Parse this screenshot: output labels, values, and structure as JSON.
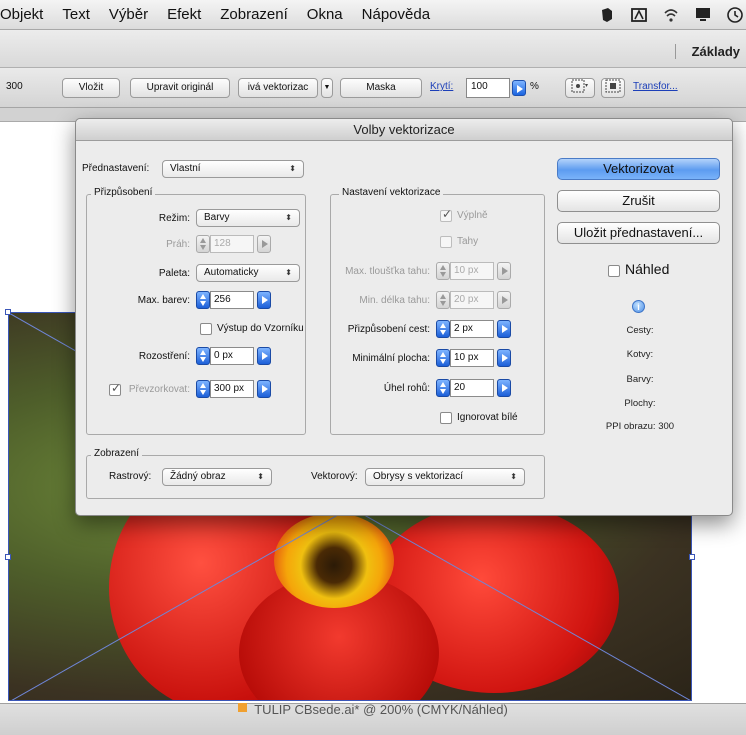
{
  "menubar": {
    "items": [
      "Objekt",
      "Text",
      "Výběr",
      "Efekt",
      "Zobrazení",
      "Okna",
      "Nápověda"
    ],
    "status_icons": [
      "evernote-icon",
      "adobe-icon",
      "wifi-icon",
      "display-icon",
      "time-machine-icon"
    ]
  },
  "appbar": {
    "workspace": "Základy"
  },
  "controlbar": {
    "left_value": "300",
    "embed_label": "Vložit",
    "edit_original_label": "Upravit originál",
    "trace_label": "ivá vektorizac",
    "mask_label": "Maska",
    "opacity_label": "Krytí:",
    "opacity_value": "100",
    "percent": "%",
    "transform_label": "Transfor..."
  },
  "document": {
    "title": "TULIP CBsede.ai* @ 200% (CMYK/Náhled)"
  },
  "dialog": {
    "title": "Volby vektorizace",
    "preset_label": "Přednastavení:",
    "preset_value": "Vlastní",
    "adjustments": {
      "title": "Přizpůsobení",
      "mode_label": "Režim:",
      "mode_value": "Barvy",
      "threshold_label": "Práh:",
      "threshold_value": "128",
      "palette_label": "Paleta:",
      "palette_value": "Automaticky",
      "max_colors_label": "Max. barev:",
      "max_colors_value": "256",
      "output_swatches_label": "Výstup do Vzorníku",
      "blur_label": "Rozostření:",
      "blur_value": "0 px",
      "resample_label": "Převzorkovat:",
      "resample_value": "300 px"
    },
    "trace_settings": {
      "title": "Nastavení vektorizace",
      "fills_label": "Výplně",
      "strokes_label": "Tahy",
      "max_stroke_label": "Max. tloušťka tahu:",
      "max_stroke_value": "10 px",
      "min_stroke_label": "Min. délka tahu:",
      "min_stroke_value": "20 px",
      "path_fitting_label": "Přizpůsobení cest:",
      "path_fitting_value": "2 px",
      "min_area_label": "Minimální plocha:",
      "min_area_value": "10 px",
      "corner_angle_label": "Úhel rohů:",
      "corner_angle_value": "20",
      "ignore_white_label": "Ignorovat bílé"
    },
    "view": {
      "title": "Zobrazení",
      "raster_label": "Rastrový:",
      "raster_value": "Žádný obraz",
      "vector_label": "Vektorový:",
      "vector_value": "Obrysy s vektorizací"
    },
    "buttons": {
      "trace": "Vektorizovat",
      "cancel": "Zrušit",
      "save_preset": "Uložit přednastavení..."
    },
    "preview_label": "Náhled",
    "info": {
      "paths": "Cesty:",
      "anchors": "Kotvy:",
      "colors": "Barvy:",
      "areas": "Plochy:",
      "ppi": "PPI obrazu: 300"
    }
  },
  "colors": {
    "accent": "#5d9cf0",
    "dialog_bg": "#ececec",
    "tulip_red": "#e0201c"
  }
}
